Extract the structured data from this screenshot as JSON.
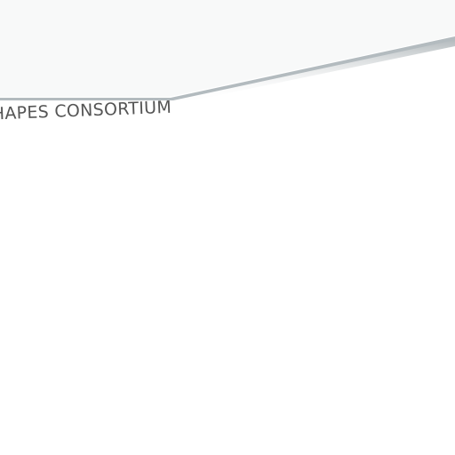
{
  "brand": {
    "text": "SHAPES CONSORTIUM"
  },
  "colors": {
    "header_fill": "#f8f9f9",
    "header_edge_shadow": "#b8bfc2",
    "brand_text": "#555555",
    "background": "#ffffff"
  }
}
